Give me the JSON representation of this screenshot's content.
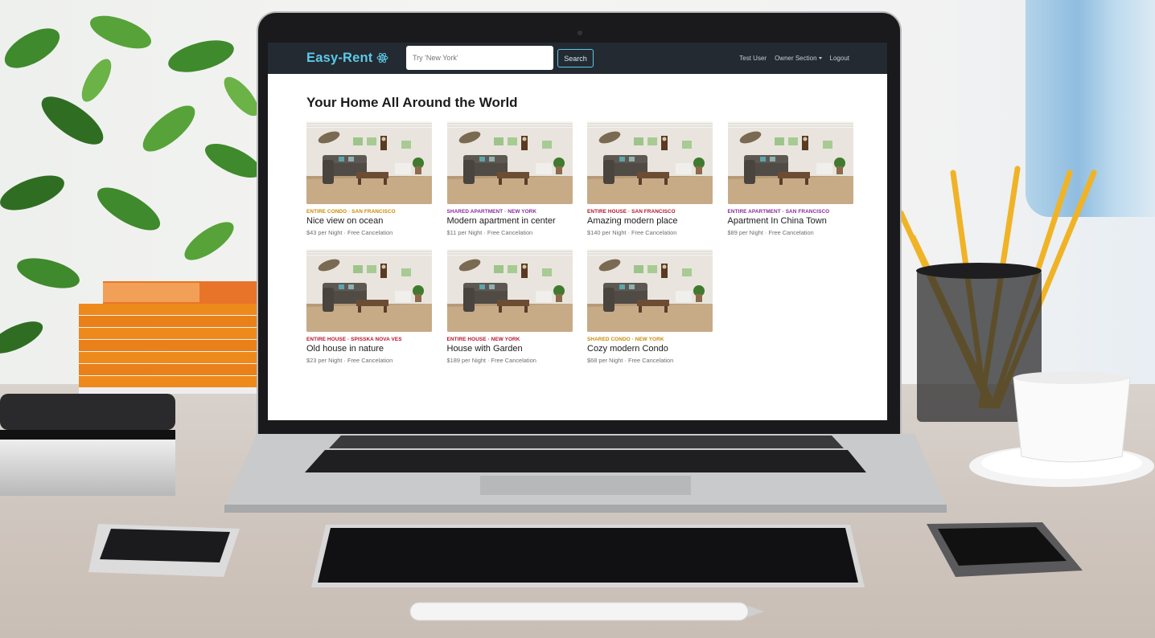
{
  "app": {
    "brand": "Easy-Rent",
    "brand_icon": "react-atom-icon",
    "brand_color": "#5dc8e8",
    "navbar_color": "#232a31"
  },
  "search": {
    "placeholder": "Try 'New York'",
    "button_label": "Search"
  },
  "nav": {
    "user": "Test User",
    "owner_section": "Owner Section",
    "logout": "Logout"
  },
  "main": {
    "title": "Your Home All Around the World"
  },
  "listings": [
    {
      "category": "ENTIRE CONDO · SAN FRANCISCO",
      "category_color": "#c98a06",
      "name": "Nice view on ocean",
      "price": "$43 per Night · Free Cancelation"
    },
    {
      "category": "SHARED APARTMENT · NEW YORK",
      "category_color": "#8a2a9c",
      "name": "Modern apartment in center",
      "price": "$11 per Night · Free Cancelation"
    },
    {
      "category": "ENTIRE HOUSE · SAN FRANCISCO",
      "category_color": "#b2152a",
      "name": "Amazing modern place",
      "price": "$140 per Night · Free Cancelation"
    },
    {
      "category": "ENTIRE APARTMENT · SAN FRANCISCO",
      "category_color": "#8a2a9c",
      "name": "Apartment In China Town",
      "price": "$89 per Night · Free Cancelation"
    },
    {
      "category": "ENTIRE HOUSE · SPISSKA NOVA VES",
      "category_color": "#b2152a",
      "name": "Old house in nature",
      "price": "$23 per Night · Free Cancelation"
    },
    {
      "category": "ENTIRE HOUSE · NEW YORK",
      "category_color": "#b2152a",
      "name": "House with Garden",
      "price": "$189 per Night · Free Cancelation"
    },
    {
      "category": "SHARED CONDO · NEW YORK",
      "category_color": "#c98a06",
      "name": "Cozy modern Condo",
      "price": "$68 per Night · Free Cancelation"
    }
  ]
}
